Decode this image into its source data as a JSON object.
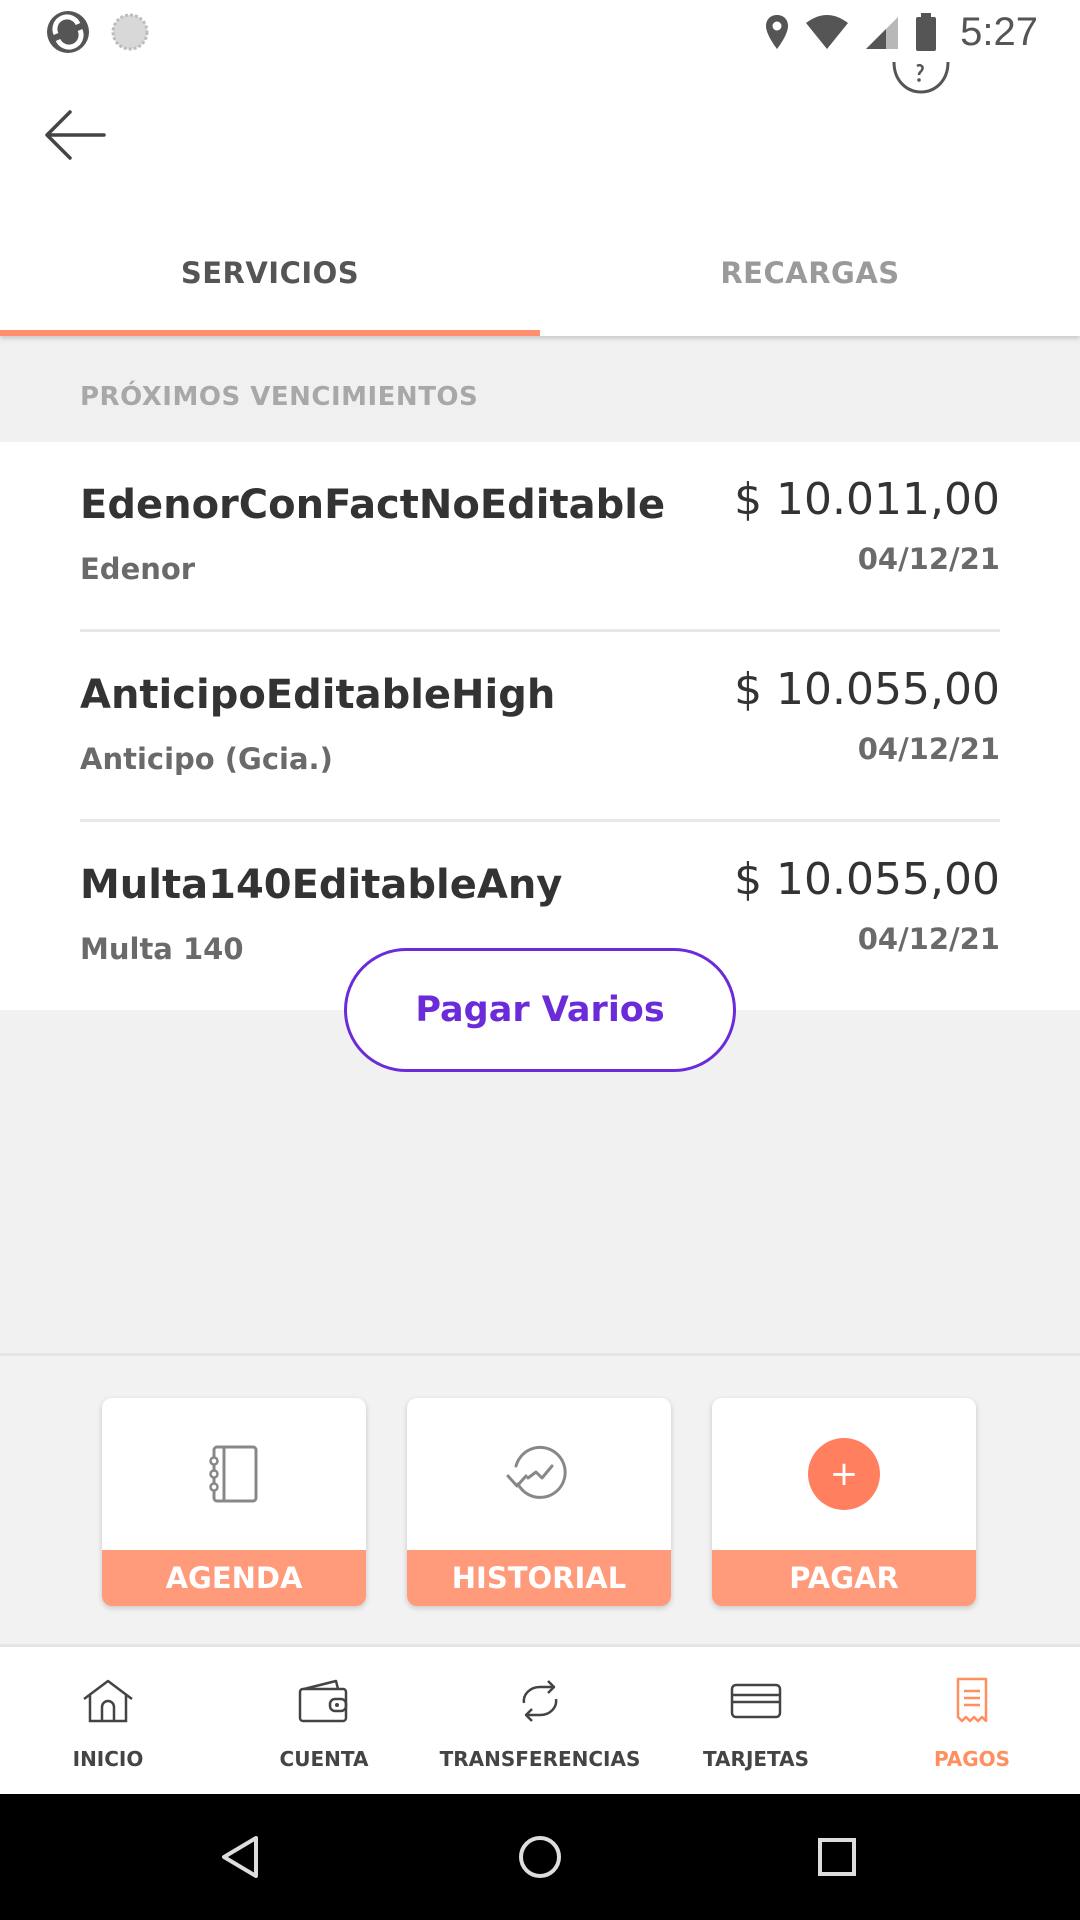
{
  "status_bar": {
    "time": "5:27"
  },
  "tabs": [
    {
      "label": "SERVICIOS",
      "active": true
    },
    {
      "label": "RECARGAS",
      "active": false
    }
  ],
  "section": {
    "title": "PRÓXIMOS VENCIMIENTOS"
  },
  "items": [
    {
      "title": "EdenorConFactNoEditable",
      "subtitle": "Edenor",
      "amount": "$ 10.011,00",
      "date": "04/12/21"
    },
    {
      "title": "AnticipoEditableHigh",
      "subtitle": "Anticipo (Gcia.)",
      "amount": "$ 10.055,00",
      "date": "04/12/21"
    },
    {
      "title": "Multa140EditableAny",
      "subtitle": "Multa 140",
      "amount": "$ 10.055,00",
      "date": "04/12/21"
    }
  ],
  "pagar_varios_label": "Pagar Varios",
  "actions": [
    {
      "label": "AGENDA",
      "icon": "agenda-icon"
    },
    {
      "label": "HISTORIAL",
      "icon": "history-icon"
    },
    {
      "label": "PAGAR",
      "icon": "plus-icon",
      "glyph": "+"
    }
  ],
  "bottom_nav": [
    {
      "label": "INICIO",
      "icon": "home-icon"
    },
    {
      "label": "CUENTA",
      "icon": "wallet-icon"
    },
    {
      "label": "TRANSFERENCIAS",
      "icon": "transfer-icon"
    },
    {
      "label": "TARJETAS",
      "icon": "card-icon"
    },
    {
      "label": "PAGOS",
      "icon": "receipt-icon",
      "active": true
    }
  ],
  "colors": {
    "accent": "#ff8f6e",
    "accent_button": "#ff9a7a",
    "purple": "#6c2bd9",
    "active_nav": "#ff8f5e"
  }
}
